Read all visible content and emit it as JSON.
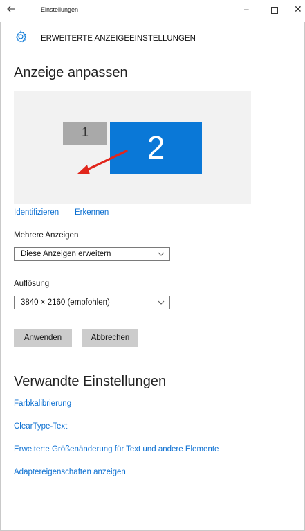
{
  "window": {
    "back_icon": "back-arrow-icon",
    "title": "Einstellungen",
    "minimize_glyph": "–",
    "close_glyph": "✕"
  },
  "header": {
    "icon": "gear-icon",
    "title": "ERWEITERTE ANZEIGEEINSTELLUNGEN"
  },
  "display": {
    "heading": "Anzeige anpassen",
    "monitors": [
      {
        "label": "1",
        "color": "#a9a9a9"
      },
      {
        "label": "2",
        "color": "#0a78d7"
      }
    ],
    "annotation_arrow_color": "#e1261c",
    "identify_link": "Identifizieren",
    "detect_link": "Erkennen"
  },
  "multiple_displays": {
    "label": "Mehrere Anzeigen",
    "value": "Diese Anzeigen erweitern"
  },
  "resolution": {
    "label": "Auflösung",
    "value": "3840 × 2160 (empfohlen)"
  },
  "buttons": {
    "apply": "Anwenden",
    "cancel": "Abbrechen"
  },
  "related": {
    "heading": "Verwandte Einstellungen",
    "links": [
      "Farbkalibrierung",
      "ClearType-Text",
      "Erweiterte Größenänderung für Text und andere Elemente",
      "Adaptereigenschaften anzeigen"
    ]
  },
  "colors": {
    "accent": "#0a78d7",
    "link": "#0b6fd1",
    "button_bg": "#cccccc",
    "preview_bg": "#f2f2f2"
  }
}
